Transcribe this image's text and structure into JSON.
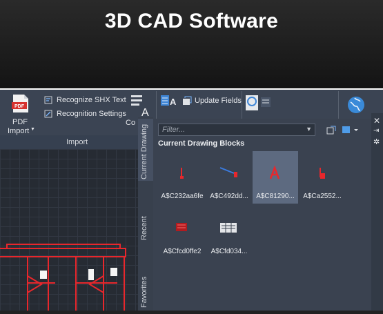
{
  "banner": {
    "title": "3D CAD Software"
  },
  "ribbon": {
    "pdf_import_label_line1": "PDF",
    "pdf_import_label_line2": "Import",
    "recognize_shx": "Recognize SHX Text",
    "recognition_settings": "Recognition Settings",
    "combine_text_partial": "Co",
    "import_group_label": "Import",
    "update_fields": "Update Fields"
  },
  "palette": {
    "filter_placeholder": "Filter...",
    "section_title": "Current Drawing Blocks",
    "tabs": [
      "Current Drawing",
      "Recent",
      "Favorites"
    ],
    "blocks": [
      {
        "name": "A$C232aa6fe",
        "selected": false
      },
      {
        "name": "A$C492dd...",
        "selected": false
      },
      {
        "name": "A$C81290...",
        "selected": true
      },
      {
        "name": "A$Ca2552...",
        "selected": false
      },
      {
        "name": "A$Cfcd0ffe2",
        "selected": false
      },
      {
        "name": "A$Cfd034...",
        "selected": false
      }
    ]
  },
  "colors": {
    "ribbon": "#3b4453",
    "palette": "#3a4250",
    "selection": "#5d6a80",
    "accent_red": "#e8272c"
  }
}
